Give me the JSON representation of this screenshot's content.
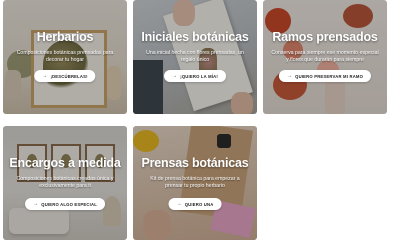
{
  "cards": [
    {
      "title": "Herbarios",
      "description": "Composiciones botánicas prensadas para decorar tu hogar",
      "cta": "¡DESCÚBRELAS!",
      "colors": {
        "frame": "#c9a46a",
        "background": "#e2d9cb"
      }
    },
    {
      "title": "Iniciales botánicas",
      "description": "Una inicial hecha con flores prensadas, un regalo único",
      "cta": "¡QUIERO LA MÍA!",
      "colors": {
        "paper": "#f7f4ee",
        "background": "#b9bec2"
      }
    },
    {
      "title": "Ramos prensados",
      "description": "Conserva para siempre ese momento especial y flores que durarán para siempre",
      "cta": "QUIERO PRESERVAR MI RAMO",
      "colors": {
        "flowers": "#c94a2c",
        "background": "#e4dbd3"
      }
    },
    {
      "title": "Encargos a medida",
      "description": "Composiciones botánicas creadas única y exclusivamente para ti",
      "cta": "QUIERO ALGO ESPECIAL",
      "colors": {
        "frame": "#8b6d4d",
        "background": "#e4e1dc"
      }
    },
    {
      "title": "Prensas botánicas",
      "description": "Kit de prensa botánica para empezar a prensar tu propio herbario",
      "cta": "QUIERO UNA",
      "colors": {
        "box": "#caa27a",
        "background": "#d8bfa8"
      }
    }
  ],
  "icons": {
    "cta_arrow": "arrow-right-icon"
  },
  "accent": "#ffffff"
}
